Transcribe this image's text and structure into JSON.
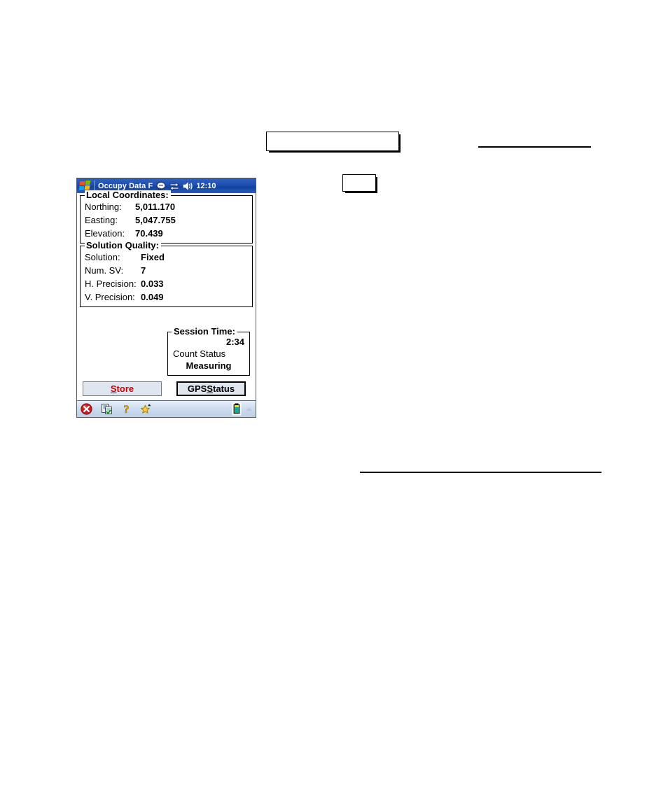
{
  "page": {
    "background": "#ffffff",
    "decorations": {
      "box_wide": "",
      "box_small": "",
      "rule_top": "",
      "rule_bottom": ""
    }
  },
  "device": {
    "titlebar": {
      "start_icon": "windows-flag-icon",
      "title": "Occupy Data F",
      "tray_icons": [
        "chat-bubble-icon",
        "connectivity-icon",
        "volume-icon"
      ],
      "clock": "12:10",
      "bg_color": "#1f4eb0",
      "text_color": "#ffffff"
    },
    "client": {
      "local_coordinates": {
        "title": "Local Coordinates:",
        "rows": [
          {
            "label": "Northing:",
            "value": "5,011.170"
          },
          {
            "label": "Easting:",
            "value": "5,047.755"
          },
          {
            "label": "Elevation:",
            "value": "70.439"
          }
        ]
      },
      "solution_quality": {
        "title": "Solution Quality:",
        "rows": [
          {
            "label": "Solution:",
            "value": "Fixed"
          },
          {
            "label": "Num. SV:",
            "value": "7"
          },
          {
            "label": "H. Precision:",
            "value": "0.033"
          },
          {
            "label": "V. Precision:",
            "value": "0.049"
          }
        ]
      },
      "session_time": {
        "title": "Session Time:",
        "elapsed": "2:34",
        "count_status_label": "Count Status",
        "count_status_value": "Measuring"
      },
      "buttons": {
        "store": {
          "prefix": "",
          "accel": "S",
          "suffix": "tore",
          "color": "#cc0000"
        },
        "gps_status": {
          "prefix": "GPS ",
          "accel": "S",
          "suffix": "tatus",
          "color": "#000000"
        }
      }
    },
    "taskbar": {
      "left_icons": [
        "close-icon",
        "notes-checklist-icon",
        "help-question-icon",
        "favorites-star-icon"
      ],
      "right_icons": [
        "battery-icon",
        "tray-expand-arrow-icon"
      ],
      "bg_color": "#cfdcee"
    }
  }
}
